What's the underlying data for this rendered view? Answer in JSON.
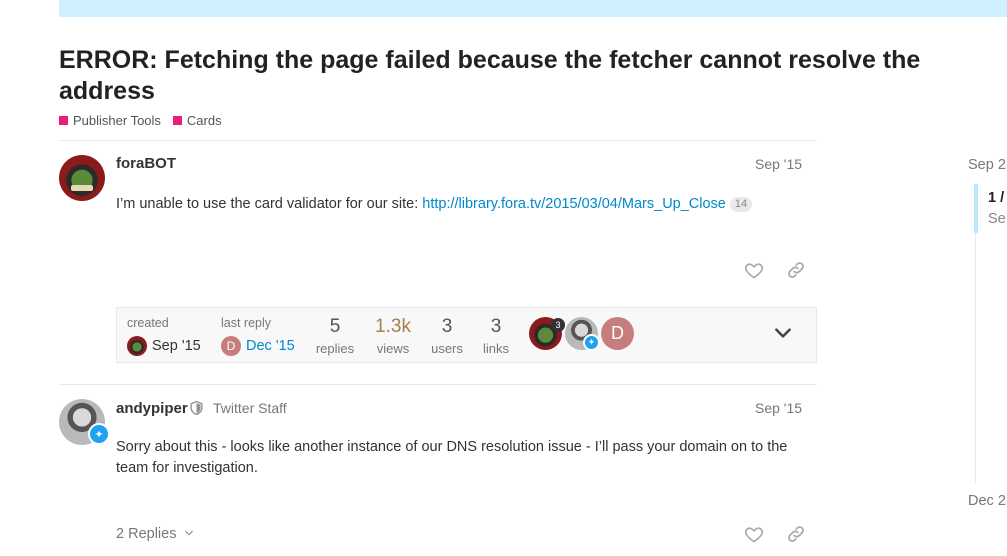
{
  "topic": {
    "title": "ERROR: Fetching the page failed because the fetcher cannot resolve the address",
    "categories": [
      {
        "label": "Publisher Tools",
        "color": "#e91e7a"
      },
      {
        "label": "Cards",
        "color": "#e91e7a"
      }
    ]
  },
  "posts": [
    {
      "username": "foraBOT",
      "date": "Sep '15",
      "body_text": "I’m unable to use the card validator for our site: ",
      "link_text": "http://library.fora.tv/2015/03/04/Mars_Up_Close",
      "link_clicks": "14",
      "avatar_icon": "zombie-avatar"
    },
    {
      "username": "andypiper",
      "user_title": "Twitter Staff",
      "date": "Sep '15",
      "body_text": "Sorry about this - looks like another instance of our DNS resolution issue - I’ll pass your domain on to the team for investigation.",
      "replies_label": "2 Replies",
      "avatar_icon": "person-avatar"
    }
  ],
  "summary": {
    "created_label": "created",
    "created_date": "Sep '15",
    "last_reply_label": "last reply",
    "last_reply_date": "Dec '15",
    "last_reply_initial": "D",
    "stats": [
      {
        "num": "5",
        "cap": "replies"
      },
      {
        "num": "1.3k",
        "cap": "views"
      },
      {
        "num": "3",
        "cap": "users"
      },
      {
        "num": "3",
        "cap": "links"
      }
    ],
    "participant_count": "3",
    "participant_initial": "D"
  },
  "timeline": {
    "start": "Sep 2",
    "position": "1 /",
    "position_sub": "Se",
    "end": "Dec 2"
  },
  "colors": {
    "link": "#0088cc",
    "banner": "#d1f0ff",
    "category": "#e91e7a",
    "twitter": "#1da1f2",
    "initial_avatar": "#c67d7d"
  }
}
